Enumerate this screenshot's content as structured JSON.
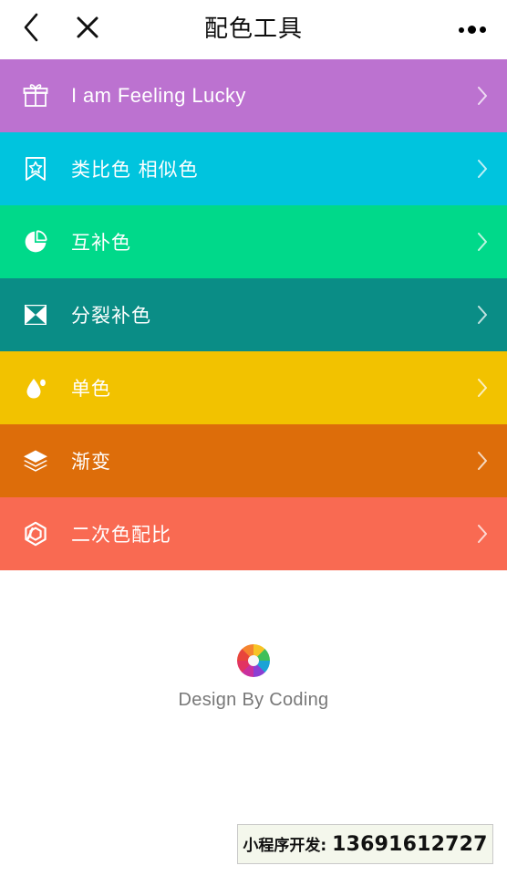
{
  "app": {
    "title": "配色工具",
    "background": "#ffffff"
  },
  "navbar": {
    "back_icon": "chevron-left-icon",
    "close_icon": "close-icon",
    "title": "配色工具",
    "more_icon": "more-options-icon"
  },
  "menu": {
    "rows": [
      {
        "label": "I am Feeling Lucky",
        "icon": "gift-icon",
        "bg": "#BC72D0",
        "script": "latin",
        "chevron": "chevron-right-icon"
      },
      {
        "label": "类比色 相似色",
        "icon": "bookmark-star-icon",
        "bg": "#00C4DE",
        "script": "cjk",
        "chevron": "chevron-right-icon"
      },
      {
        "label": "互补色",
        "icon": "pie-chart-icon",
        "bg": "#00D98A",
        "script": "cjk",
        "chevron": "chevron-right-icon"
      },
      {
        "label": "分裂补色",
        "icon": "hourglass-square-icon",
        "bg": "#0A8D86",
        "script": "cjk",
        "chevron": "chevron-right-icon"
      },
      {
        "label": "单色",
        "icon": "water-drop-icon",
        "bg": "#F2C200",
        "script": "cjk",
        "chevron": "chevron-right-icon"
      },
      {
        "label": "渐变",
        "icon": "layers-icon",
        "bg": "#DD6D0A",
        "script": "cjk",
        "chevron": "chevron-right-icon"
      },
      {
        "label": "二次色配比",
        "icon": "hexagon-icon",
        "bg": "#F96A52",
        "script": "cjk",
        "chevron": "chevron-right-icon"
      }
    ]
  },
  "brand": {
    "logo_icon": "color-wheel-icon",
    "caption": "Design By Coding",
    "wheel_colors": [
      "#E8453C",
      "#F5842F",
      "#F7C325",
      "#3FBF5A",
      "#1BA3D6",
      "#8B3FD4",
      "#C9309E",
      "#E23461"
    ]
  },
  "promo": {
    "prefix": "小程序开发:",
    "phone": "13691612727",
    "bg": "#f4f7ec",
    "border": "#c9c9c9"
  }
}
